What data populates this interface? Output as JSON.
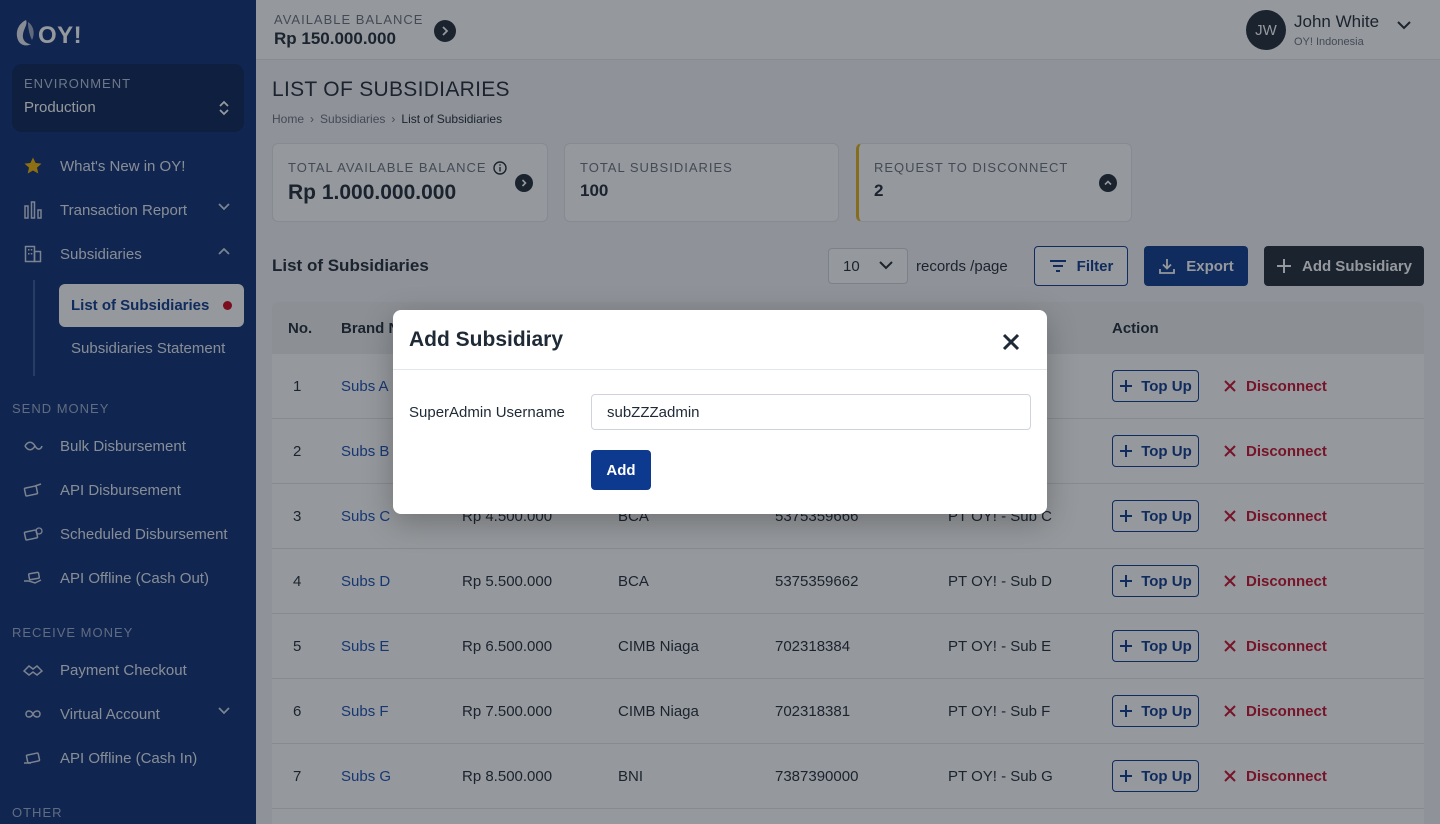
{
  "brand": {
    "logo_text": "OY!"
  },
  "sidebar": {
    "environment": {
      "label": "ENVIRONMENT",
      "value": "Production"
    },
    "items": [
      {
        "label": "What's New in OY!"
      },
      {
        "label": "Transaction Report"
      },
      {
        "label": "Subsidiaries"
      }
    ],
    "sub_items": [
      {
        "label": "List of Subsidiaries"
      },
      {
        "label": "Subsidiaries Statement"
      }
    ],
    "sections": {
      "send_money": "SEND MONEY",
      "receive_money": "RECEIVE MONEY",
      "other": "OTHER"
    },
    "send_money_items": [
      {
        "label": "Bulk Disbursement"
      },
      {
        "label": "API Disbursement"
      },
      {
        "label": "Scheduled Disbursement"
      },
      {
        "label": "API Offline (Cash Out)"
      }
    ],
    "receive_money_items": [
      {
        "label": "Payment Checkout"
      },
      {
        "label": "Virtual Account"
      },
      {
        "label": "API Offline (Cash In)"
      }
    ]
  },
  "topbar": {
    "balance_label": "AVAILABLE BALANCE",
    "balance_value": "Rp 150.000.000",
    "user_initials": "JW",
    "user_name": "John White",
    "user_org": "OY! Indonesia"
  },
  "page": {
    "title": "LIST OF SUBSIDIARIES",
    "breadcrumb": [
      "Home",
      "Subsidiaries",
      "List of Subsidiaries"
    ]
  },
  "stats": [
    {
      "label": "TOTAL AVAILABLE BALANCE",
      "value": "Rp 1.000.000.000"
    },
    {
      "label": "TOTAL SUBSIDIARIES",
      "value": "100"
    },
    {
      "label": "REQUEST TO DISCONNECT",
      "value": "2"
    }
  ],
  "list": {
    "title": "List of Subsidiaries",
    "records_per_page": "10",
    "records_label": "records /page",
    "filter_label": "Filter",
    "export_label": "Export",
    "add_label": "Add Subsidiary"
  },
  "table": {
    "headers": {
      "no": "No.",
      "brand": "Brand Name",
      "action": "Action"
    },
    "topup_label": "Top Up",
    "disconnect_label": "Disconnect",
    "rows": [
      {
        "no": "1",
        "brand": "Subs A",
        "balance": "",
        "bank": "",
        "account": "",
        "name": ""
      },
      {
        "no": "2",
        "brand": "Subs B",
        "balance": "",
        "bank": "",
        "account": "",
        "name": ""
      },
      {
        "no": "3",
        "brand": "Subs C",
        "balance": "Rp 4.500.000",
        "bank": "BCA",
        "account": "5375359666",
        "name": "PT OY!  - Sub C"
      },
      {
        "no": "4",
        "brand": "Subs D",
        "balance": "Rp 5.500.000",
        "bank": "BCA",
        "account": "5375359662",
        "name": "PT OY!  - Sub D"
      },
      {
        "no": "5",
        "brand": "Subs E",
        "balance": "Rp 6.500.000",
        "bank": "CIMB Niaga",
        "account": "702318384",
        "name": "PT OY!  - Sub E"
      },
      {
        "no": "6",
        "brand": "Subs F",
        "balance": "Rp 7.500.000",
        "bank": "CIMB Niaga",
        "account": "702318381",
        "name": "PT OY!  - Sub F"
      },
      {
        "no": "7",
        "brand": "Subs G",
        "balance": "Rp 8.500.000",
        "bank": "BNI",
        "account": "7387390000",
        "name": "PT OY!  - Sub G"
      }
    ]
  },
  "modal": {
    "title": "Add Subsidiary",
    "field_label": "SuperAdmin Username",
    "field_value": "subZZZadmin",
    "submit_label": "Add"
  },
  "colors": {
    "sidebar_bg": "#0d2f73",
    "primary": "#0d3a8f",
    "danger": "#c8102e",
    "active_dot": "#d0021b",
    "warning_accent": "#e0b21a"
  }
}
